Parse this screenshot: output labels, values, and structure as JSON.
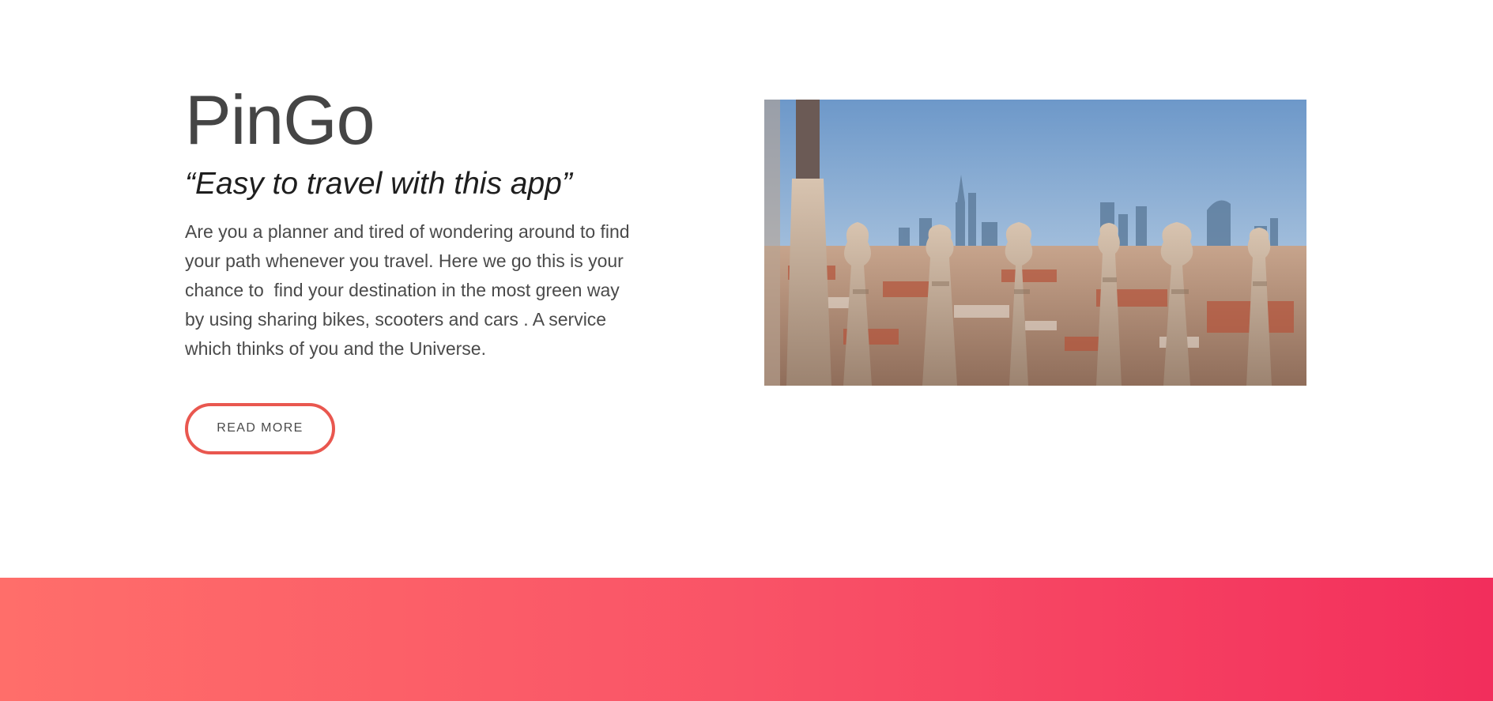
{
  "hero": {
    "title": "PinGo",
    "tagline": "“Easy to travel with this app”",
    "description": "Are you a planner and tired of wondering around to find your path whenever you travel. Here we go this is your chance to  find your destination in the most green way by using sharing bikes, scooters and cars . A service which thinks of you and the Universe.",
    "read_more_label": "READ MORE",
    "image_icon": "city-skyline-photo"
  },
  "colors": {
    "accent": "#e9574f",
    "gradient_start": "#ff6e6a",
    "gradient_end": "#f22e5c",
    "title": "#454545",
    "body_text": "#4a4a4a"
  }
}
